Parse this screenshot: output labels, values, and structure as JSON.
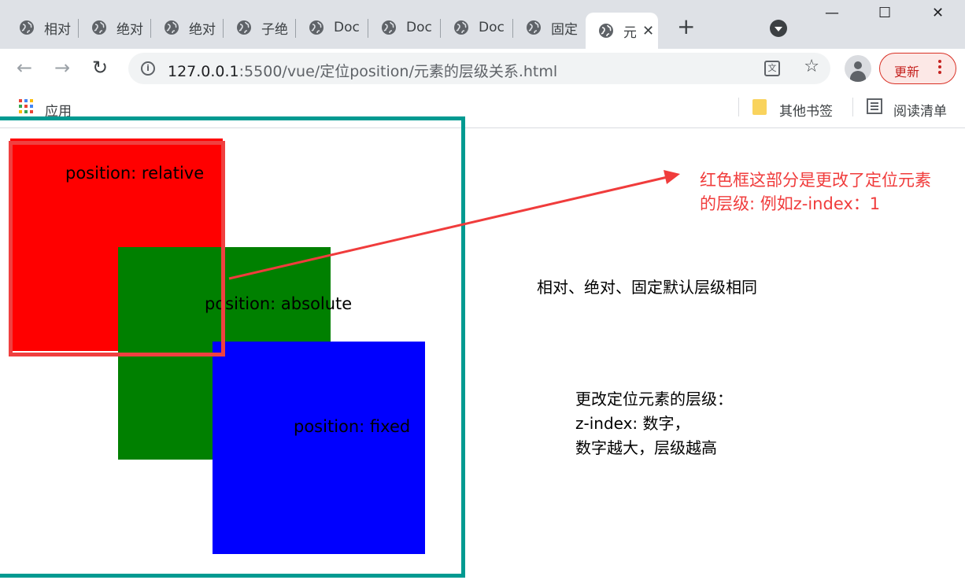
{
  "browser": {
    "tabs": [
      {
        "title": "相对"
      },
      {
        "title": "绝对"
      },
      {
        "title": "绝对"
      },
      {
        "title": "子绝"
      },
      {
        "title": "Doc"
      },
      {
        "title": "Doc"
      },
      {
        "title": "Doc"
      },
      {
        "title": "固定"
      },
      {
        "title": "元",
        "active": true
      }
    ],
    "new_tab": "+",
    "window": {
      "minimize": "—",
      "maximize": "☐",
      "close": "✕"
    },
    "url_host": "127.0.0.1",
    "url_rest": ":5500/vue/定位position/元素的层级关系.html",
    "update_label": "更新",
    "bookmarks": {
      "apps_label": "应用",
      "other_label": "其他书签",
      "reading_list_label": "阅读清单"
    },
    "icons": [
      "globe-icon",
      "back-icon",
      "forward-icon",
      "reload-icon",
      "info-icon",
      "translate-icon",
      "star-icon",
      "profile-icon",
      "menu-icon",
      "apps-grid-icon",
      "folder-icon",
      "reading-list-icon"
    ]
  },
  "page": {
    "boxes": {
      "relative": "position: relative",
      "absolute": "position: absolute",
      "fixed": "position: fixed"
    },
    "notes": {
      "default_level": "相对、绝对、固定默认层级相同",
      "change_line1": "更改定位元素的层级：",
      "change_line2": "z-index: 数字，",
      "change_line3": "数字越大，层级越高"
    },
    "callout": {
      "line1": "红色框这部分是更改了定位元素",
      "line2": "的层级: 例如z-index：1"
    },
    "colors": {
      "container_border": "#009a91",
      "relative_box": "#ff0000",
      "absolute_box": "#008000",
      "fixed_box": "#0000ff",
      "annotation": "#f03c3c"
    }
  }
}
